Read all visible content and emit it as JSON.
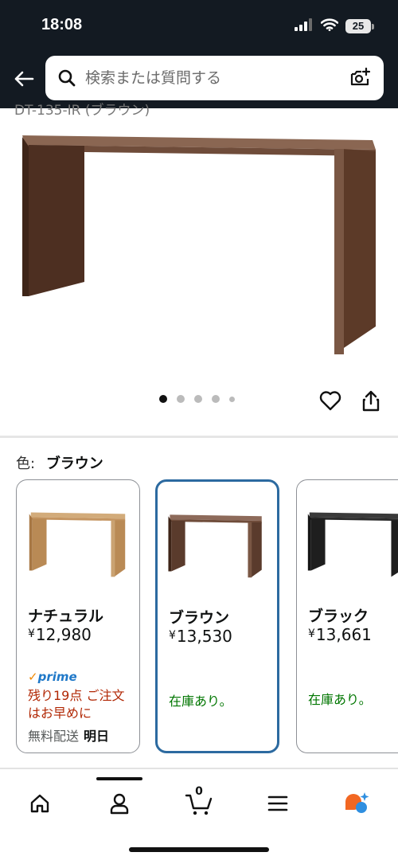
{
  "status_bar": {
    "time": "18:08",
    "battery": "25"
  },
  "search": {
    "placeholder": "検索または質問する"
  },
  "product": {
    "cut_title": "DT-135-IR (ブラウン)"
  },
  "carousel": {
    "total": 5,
    "active": 1
  },
  "color_selector": {
    "label": "色:",
    "selected": "ブラウン",
    "options": [
      {
        "name": "ナチュラル",
        "price": "12,980",
        "currency": "¥",
        "prime": "prime",
        "stock_note": "残り19点 ご注文はお早めに",
        "shipping_label": "無料配送",
        "shipping_day": "明日",
        "top_color": "#d2ab7a",
        "leg_color": "#b98a55"
      },
      {
        "name": "ブラウン",
        "price": "13,530",
        "currency": "¥",
        "stock_note": "在庫あり。",
        "top_color": "#8d6a5a",
        "leg_color": "#5a3b2c"
      },
      {
        "name": "ブラック",
        "price": "13,661",
        "currency": "¥",
        "stock_note": "在庫あり。",
        "top_color": "#3a3a3a",
        "leg_color": "#1e1e1e"
      }
    ]
  },
  "bottom_nav": {
    "items": [
      "home",
      "account",
      "cart",
      "menu",
      "rufus"
    ],
    "cart_count": "0"
  },
  "colors": {
    "header_bg": "#131a22",
    "selected_border": "#2c6aa0",
    "in_stock": "#007600",
    "low_stock": "#b12704",
    "prime_blue": "#1f78c8"
  }
}
